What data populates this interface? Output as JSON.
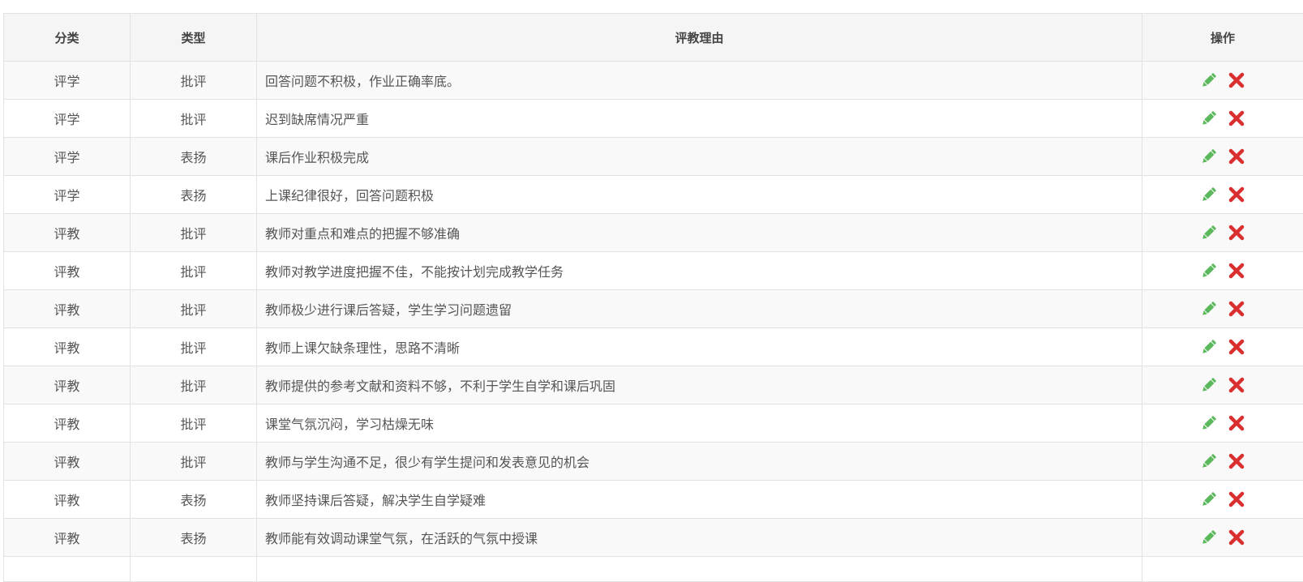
{
  "table": {
    "headers": {
      "category": "分类",
      "type": "类型",
      "reason": "评教理由",
      "actions": "操作"
    },
    "rows": [
      {
        "category": "评学",
        "type": "批评",
        "reason": "回答问题不积极，作业正确率底。"
      },
      {
        "category": "评学",
        "type": "批评",
        "reason": "迟到缺席情况严重"
      },
      {
        "category": "评学",
        "type": "表扬",
        "reason": "课后作业积极完成"
      },
      {
        "category": "评学",
        "type": "表扬",
        "reason": "上课纪律很好，回答问题积极"
      },
      {
        "category": "评教",
        "type": "批评",
        "reason": "教师对重点和难点的把握不够准确"
      },
      {
        "category": "评教",
        "type": "批评",
        "reason": "教师对教学进度把握不佳，不能按计划完成教学任务"
      },
      {
        "category": "评教",
        "type": "批评",
        "reason": "教师极少进行课后答疑，学生学习问题遗留"
      },
      {
        "category": "评教",
        "type": "批评",
        "reason": "教师上课欠缺条理性，思路不清晰"
      },
      {
        "category": "评教",
        "type": "批评",
        "reason": "教师提供的参考文献和资料不够，不利于学生自学和课后巩固"
      },
      {
        "category": "评教",
        "type": "批评",
        "reason": "课堂气氛沉闷，学习枯燥无味"
      },
      {
        "category": "评教",
        "type": "批评",
        "reason": "教师与学生沟通不足，很少有学生提问和发表意见的机会"
      },
      {
        "category": "评教",
        "type": "表扬",
        "reason": "教师坚持课后答疑，解决学生自学疑难"
      },
      {
        "category": "评教",
        "type": "表扬",
        "reason": "教师能有效调动课堂气氛，在活跃的气氛中授课"
      }
    ],
    "icons": {
      "edit": "pencil-icon",
      "delete": "close-icon"
    },
    "colors": {
      "edit": "#5cb85c",
      "delete": "#d9302f"
    }
  }
}
